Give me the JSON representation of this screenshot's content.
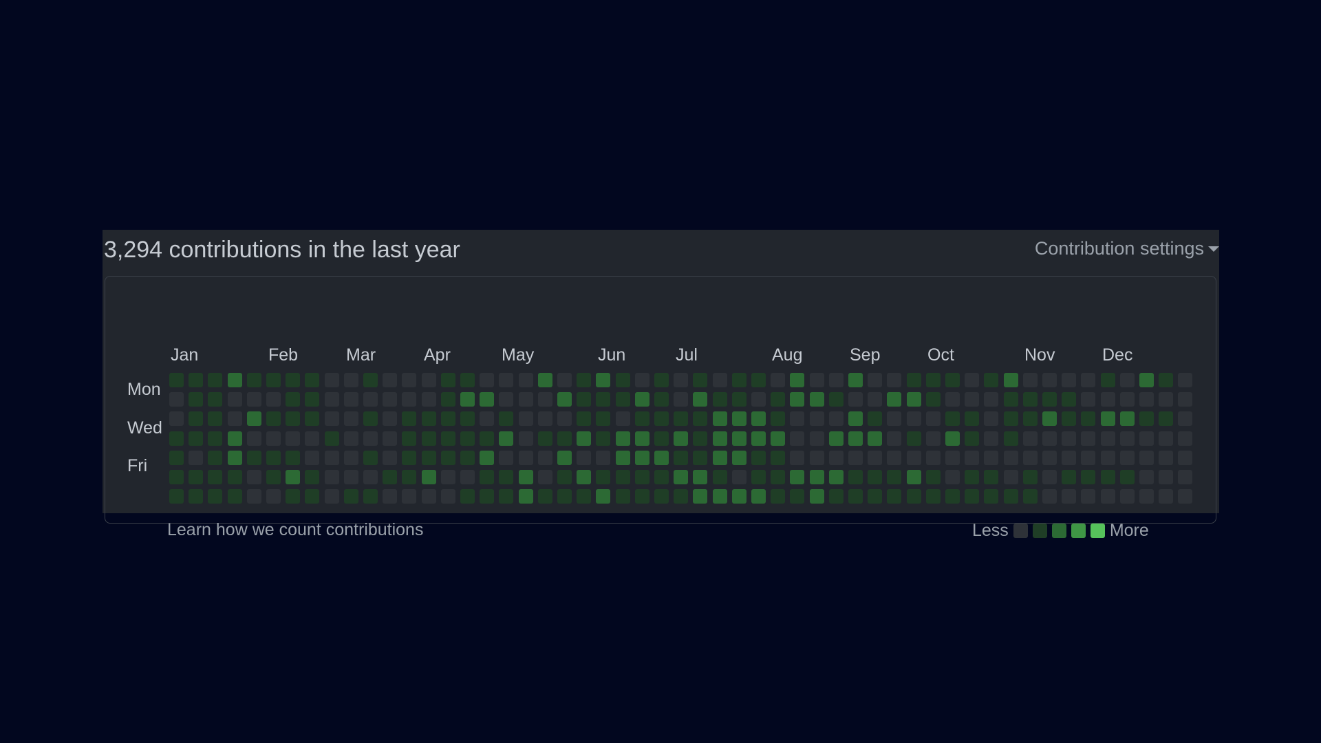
{
  "title": "3,294 contributions in the last year",
  "settings_label": "Contribution settings",
  "months": [
    "Jan",
    "Feb",
    "Mar",
    "Apr",
    "May",
    "Jun",
    "Jul",
    "Aug",
    "Sep",
    "Oct",
    "Nov",
    "Dec"
  ],
  "month_weeks": [
    0,
    5,
    9,
    13,
    17,
    22,
    26,
    31,
    35,
    39,
    44,
    48
  ],
  "days": {
    "mon": "Mon",
    "wed": "Wed",
    "fri": "Fri"
  },
  "learn_link": "Learn how we count contributions",
  "legend": {
    "less": "Less",
    "more": "More"
  },
  "colors": [
    "#2e3238",
    "#1f3e26",
    "#2c6a34",
    "#3f9645",
    "#56c25b"
  ],
  "grid_rows": [
    "11121111001000110002012101010110200200111012000010210111",
    "01100011000000122000211121021101221002210001111",
    "01102111001011110100011011112221000210001101121122110012",
    "11120000100011111201121221212222002220102101",
    "10121110001011112000200222112211",
    "11110121000112001120121111221011222111210110101111",
    "11110011011000011121112111122221121111111111100"
  ]
}
